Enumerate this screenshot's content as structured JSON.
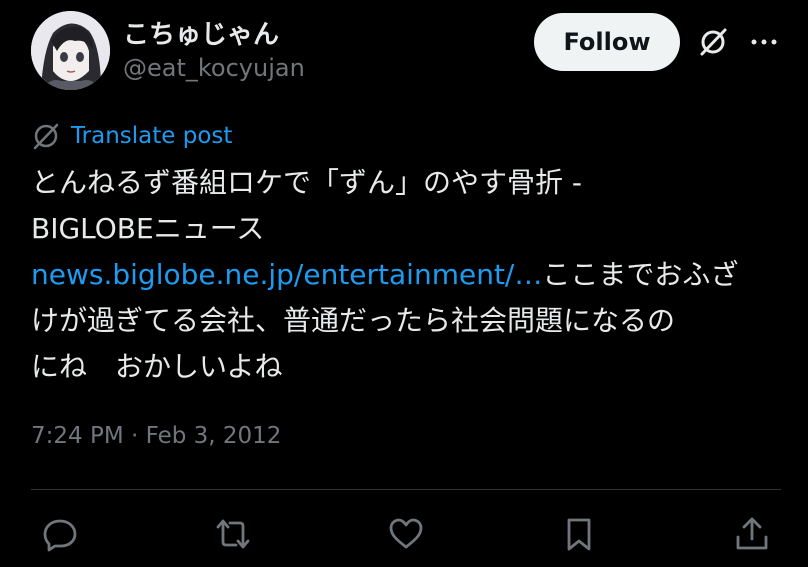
{
  "user": {
    "display_name": "こちゅじゃん",
    "handle": "@eat_kocyujan",
    "avatar_icon": "anime-avatar"
  },
  "header": {
    "follow_label": "Follow",
    "grok_icon": "grok-icon",
    "more_icon": "more-icon"
  },
  "translate": {
    "label": "Translate post",
    "icon": "translate-globe-icon"
  },
  "tweet": {
    "line1": "とんねるず番組ロケで「ずん」のやす骨折 -",
    "line2": "BIGLOBEニュース",
    "link": "news.biglobe.ne.jp/entertainment/…",
    "line3_rest": "ここまでおふざ",
    "line4": "けが過ぎてる会社、普通だったら社会問題になるの",
    "line5": "にね　おかしいよね"
  },
  "meta": {
    "timestamp": "7:24 PM · Feb 3, 2012"
  },
  "actions": [
    "reply-icon",
    "repost-icon",
    "like-icon",
    "bookmark-icon",
    "share-icon"
  ],
  "colors": {
    "background": "#000000",
    "text": "#e7e9ea",
    "secondary": "#71767b",
    "link": "#1d9bf0",
    "button_bg": "#eff3f4"
  }
}
